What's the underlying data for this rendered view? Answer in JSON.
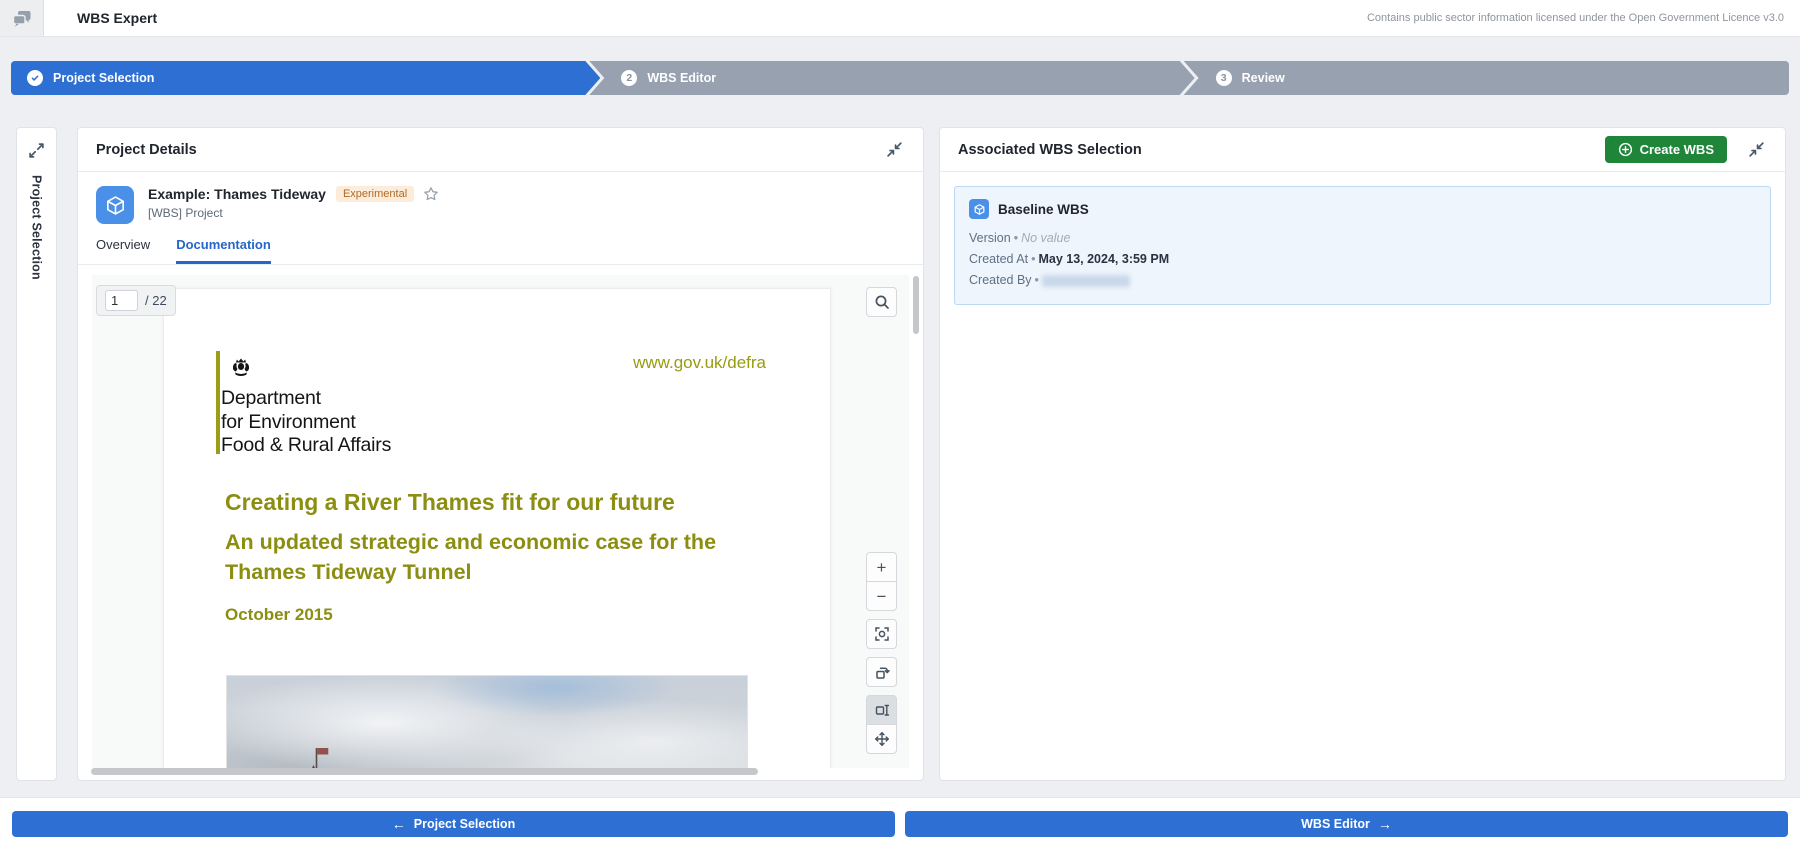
{
  "app": {
    "title": "WBS Expert",
    "license": "Contains public sector information licensed under the Open Government Licence v3.0"
  },
  "stepper": {
    "steps": [
      {
        "number": "1",
        "label": "Project Selection",
        "state": "active"
      },
      {
        "number": "2",
        "label": "WBS Editor",
        "state": "upcoming"
      },
      {
        "number": "3",
        "label": "Review",
        "state": "upcoming"
      }
    ]
  },
  "side_rail": {
    "label": "Project Selection"
  },
  "project_panel": {
    "title": "Project Details",
    "project": {
      "name": "Example: Thames Tideway",
      "badge": "Experimental",
      "type": "[WBS] Project"
    },
    "tabs": [
      {
        "label": "Overview",
        "active": false
      },
      {
        "label": "Documentation",
        "active": true
      }
    ],
    "pdf": {
      "page": "1",
      "page_count": "/ 22",
      "controls": {
        "zoom_in": "+",
        "zoom_out": "−"
      },
      "doc": {
        "website": "www.gov.uk/defra",
        "org_line1": "Department",
        "org_line2": "for Environment",
        "org_line3": "Food & Rural Affairs",
        "title": "Creating a River Thames fit for our future",
        "subtitle": "An updated strategic and economic case for the Thames Tideway Tunnel",
        "date": "October 2015"
      }
    }
  },
  "wbs_panel": {
    "title": "Associated WBS Selection",
    "create_button": "Create WBS",
    "card": {
      "name": "Baseline WBS",
      "fields": [
        {
          "label": "Version",
          "value": "No value"
        },
        {
          "label": "Created At",
          "value": "May 13, 2024, 3:59 PM"
        },
        {
          "label": "Created By",
          "value": ""
        }
      ]
    }
  },
  "footer": {
    "back_arrow": "←",
    "back_label": "Project Selection",
    "next_label": "WBS Editor",
    "next_arrow": "→"
  },
  "colors": {
    "accent_blue": "#2e6fd4",
    "step_gray": "#98a1b0",
    "green": "#1e8539",
    "olive_heading": "#8c8e11",
    "badge_bg": "#fcecd9",
    "badge_text": "#ad6c26",
    "card_bg": "#eef5fc",
    "card_border": "#bcd8f2"
  }
}
